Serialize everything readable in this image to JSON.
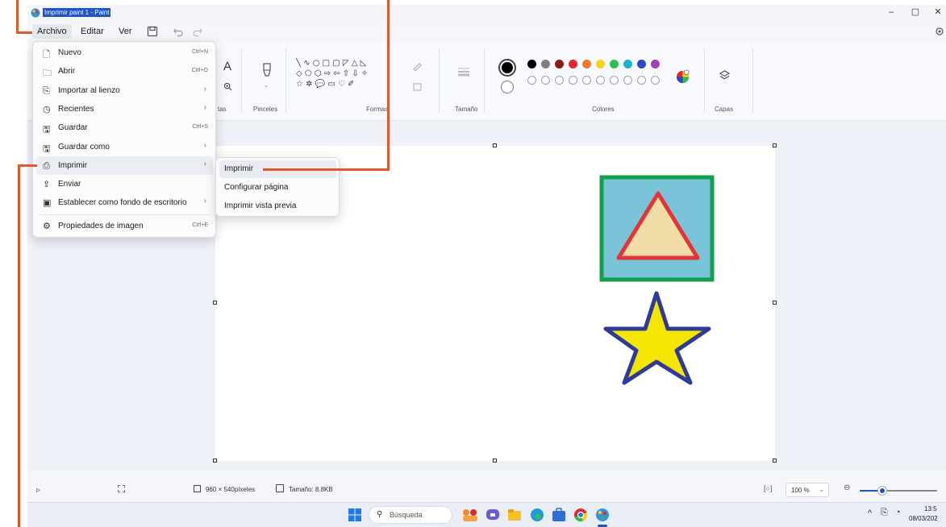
{
  "window": {
    "title": "Imprimir paint 1 - Paint"
  },
  "menubar": {
    "file": "Archivo",
    "edit": "Editar",
    "view": "Ver"
  },
  "ribbon": {
    "groups": {
      "tools_partial": "tas",
      "brushes": "Pinceles",
      "shapes": "Formas",
      "size": "Tamaño",
      "colors": "Colores",
      "layers": "Capas"
    },
    "shapes_row1": "╲ ∿ ○ □ ▢ ◸ △ ◺",
    "shapes_row2": "◇ ⬠ ⬡ ⇨ ⇦ ⇧ ⇩ ✧",
    "shapes_row3": "☆ ✲ 💬 ▭ ♡ ✐",
    "text_tool": "A",
    "palette_row1": [
      "#000000",
      "#7f7f7f",
      "#8b1a1a",
      "#e5262d",
      "#f07a2a",
      "#f7d11b",
      "#2ebf4f",
      "#17b6cd",
      "#3048c8",
      "#a23fb8"
    ],
    "palette_row2": [
      "#ffffff",
      "#c3c3c3",
      "#b5795a",
      "#f2a6c4",
      "#f5c12a",
      "#f1eb8f",
      "#b4e061",
      "#9fd8ea",
      "#7a92c9",
      "#c6b3da"
    ],
    "primary_color": "#000000",
    "secondary_color": "#ffffff"
  },
  "file_menu": {
    "items": [
      {
        "label": "Nuevo",
        "shortcut": "Ctrl+N",
        "icon": "new-file-icon"
      },
      {
        "label": "Abrir",
        "shortcut": "Ctrl+O",
        "icon": "folder-icon"
      },
      {
        "label": "Importar al lienzo",
        "shortcut": "›",
        "icon": "import-icon"
      },
      {
        "label": "Recientes",
        "shortcut": "›",
        "icon": "clock-icon"
      },
      {
        "label": "Guardar",
        "shortcut": "Ctrl+S",
        "icon": "save-icon"
      },
      {
        "label": "Guardar como",
        "shortcut": "›",
        "icon": "save-as-icon"
      },
      {
        "label": "Imprimir",
        "shortcut": "›",
        "icon": "printer-icon"
      },
      {
        "label": "Enviar",
        "shortcut": "",
        "icon": "share-icon"
      },
      {
        "label": "Establecer como fondo de escritorio",
        "shortcut": "›",
        "icon": "wallpaper-icon"
      },
      {
        "label": "Propiedades de imagen",
        "shortcut": "Ctrl+E",
        "icon": "properties-icon"
      }
    ]
  },
  "print_submenu": {
    "items": [
      "Imprimir",
      "Configurar página",
      "Imprimir vista previa"
    ]
  },
  "canvas_art": {
    "square_fill": "#79c4d8",
    "square_border": "#12a04a",
    "triangle_fill": "#f1dba6",
    "triangle_border": "#e2353a",
    "star_fill": "#f4e600",
    "star_border": "#2f3b96"
  },
  "statusbar": {
    "dimensions": "960 × 540píxeles",
    "size": "Tamaño: 8.8KB",
    "zoom": "100 %"
  },
  "taskbar": {
    "search": "Búsqueda",
    "time": "13:5",
    "date": "08/03/202"
  }
}
